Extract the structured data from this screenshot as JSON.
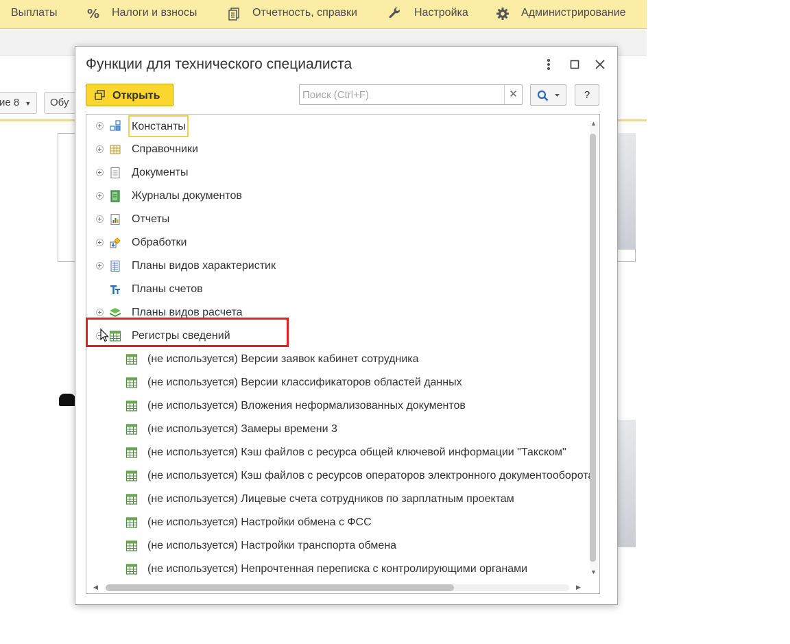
{
  "menubar": {
    "items": [
      {
        "label": "Выплаты",
        "icon": "none"
      },
      {
        "label": "Налоги и взносы",
        "icon": "percent-icon"
      },
      {
        "label": "Отчетность, справки",
        "icon": "documents-icon"
      },
      {
        "label": "Настройка",
        "icon": "wrench-icon"
      },
      {
        "label": "Администрирование",
        "icon": "gear-icon"
      }
    ]
  },
  "background": {
    "button_left": "ие 8",
    "button_right": "Обу"
  },
  "dialog": {
    "title": "Функции для технического специалиста",
    "open_button": "Открыть",
    "search": {
      "placeholder": "Поиск (Ctrl+F)",
      "value": ""
    },
    "clear_symbol": "✕",
    "help_label": "?",
    "tree": [
      {
        "label": "Константы",
        "icon": "constants-icon",
        "expander": "plus",
        "selected": true
      },
      {
        "label": "Справочники",
        "icon": "catalogs-icon",
        "expander": "plus"
      },
      {
        "label": "Документы",
        "icon": "documents-icon",
        "expander": "plus"
      },
      {
        "label": "Журналы документов",
        "icon": "document-journals-icon",
        "expander": "plus"
      },
      {
        "label": "Отчеты",
        "icon": "reports-icon",
        "expander": "plus"
      },
      {
        "label": "Обработки",
        "icon": "data-processors-icon",
        "expander": "plus"
      },
      {
        "label": "Планы видов характеристик",
        "icon": "characteristic-types-icon",
        "expander": "plus"
      },
      {
        "label": "Планы счетов",
        "icon": "charts-of-accounts-icon",
        "expander": "none"
      },
      {
        "label": "Планы видов расчета",
        "icon": "calculation-types-icon",
        "expander": "plus"
      },
      {
        "label": "Регистры сведений",
        "icon": "information-registers-icon",
        "expander": "minus",
        "highlighted": true
      },
      {
        "label": "(не используется) Версии заявок кабинет сотрудника",
        "icon": "register-icon",
        "child": true
      },
      {
        "label": "(не используется) Версии классификаторов областей данных",
        "icon": "register-icon",
        "child": true
      },
      {
        "label": "(не используется) Вложения неформализованных документов",
        "icon": "register-icon",
        "child": true
      },
      {
        "label": "(не используется) Замеры времени 3",
        "icon": "register-icon",
        "child": true
      },
      {
        "label": "(не используется) Кэш файлов с ресурса общей ключевой информации \"Такском\"",
        "icon": "register-icon",
        "child": true
      },
      {
        "label": "(не используется) Кэш файлов с ресурсов операторов электронного документооборота",
        "icon": "register-icon",
        "child": true
      },
      {
        "label": "(не используется) Лицевые счета сотрудников по зарплатным проектам",
        "icon": "register-icon",
        "child": true
      },
      {
        "label": "(не используется) Настройки обмена с ФСС",
        "icon": "register-icon",
        "child": true
      },
      {
        "label": "(не используется) Настройки транспорта обмена",
        "icon": "register-icon",
        "child": true
      },
      {
        "label": "(не используется) Непрочтенная переписка с контролирующими органами",
        "icon": "register-icon",
        "child": true
      }
    ]
  },
  "colors": {
    "menubar": "#fbeda5",
    "open_button": "#fad62f",
    "highlight_frame": "#e31f26",
    "selection_border": "#f6cd52"
  }
}
